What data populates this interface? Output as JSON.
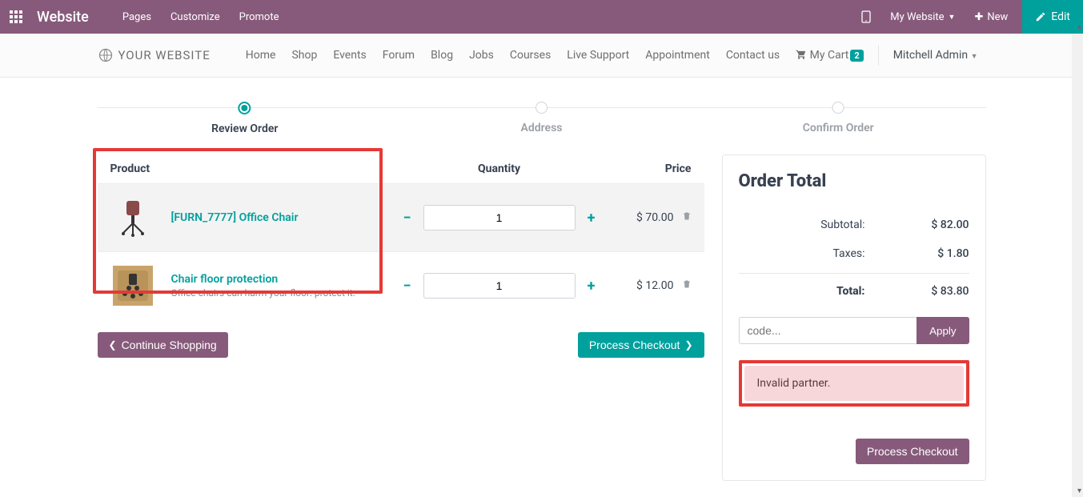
{
  "topbar": {
    "brand": "Website",
    "links": [
      "Pages",
      "Customize",
      "Promote"
    ],
    "my_website": "My Website",
    "new": "New",
    "edit": "Edit"
  },
  "subnav": {
    "logo_text": "YOUR WEBSITE",
    "links": [
      "Home",
      "Shop",
      "Events",
      "Forum",
      "Blog",
      "Jobs",
      "Courses",
      "Live Support",
      "Appointment",
      "Contact us"
    ],
    "cart_label": "My Cart",
    "cart_count": "2",
    "user": "Mitchell Admin"
  },
  "wizard": {
    "steps": [
      "Review Order",
      "Address",
      "Confirm Order"
    ],
    "active": 0
  },
  "table": {
    "headers": {
      "product": "Product",
      "quantity": "Quantity",
      "price": "Price"
    },
    "rows": [
      {
        "name": "[FURN_7777] Office Chair",
        "desc": "",
        "qty": "1",
        "price": "$ 70.00"
      },
      {
        "name": "Chair floor protection",
        "desc": "Office chairs can harm your floor: protect it.",
        "qty": "1",
        "price": "$ 12.00"
      }
    ]
  },
  "actions": {
    "continue": "Continue Shopping",
    "process": "Process Checkout"
  },
  "order": {
    "title": "Order Total",
    "subtotal_label": "Subtotal:",
    "subtotal": "$ 82.00",
    "taxes_label": "Taxes:",
    "taxes": "$ 1.80",
    "total_label": "Total:",
    "total": "$ 83.80",
    "promo_placeholder": "code...",
    "apply": "Apply",
    "error": "Invalid partner.",
    "checkout": "Process Checkout"
  }
}
